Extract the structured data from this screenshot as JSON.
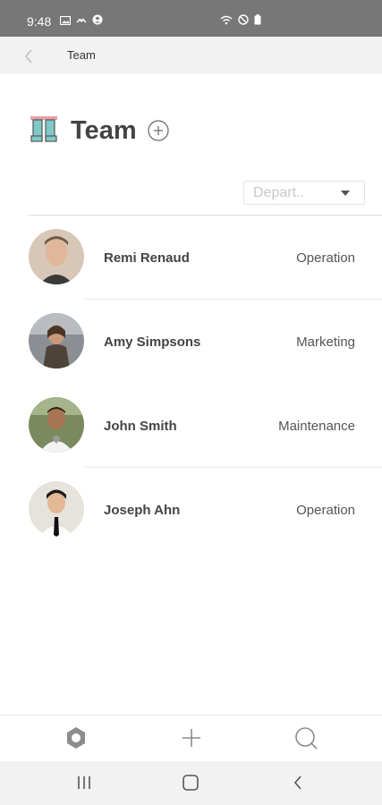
{
  "status_bar": {
    "time": "9:48"
  },
  "app_bar": {
    "title": "Team"
  },
  "header": {
    "title": "Team"
  },
  "filter": {
    "department_placeholder": "Depart..",
    "selected": ""
  },
  "members": [
    {
      "name": "Remi Renaud",
      "department": "Operation"
    },
    {
      "name": "Amy Simpsons",
      "department": "Marketing"
    },
    {
      "name": "John Smith",
      "department": "Maintenance"
    },
    {
      "name": "Joseph Ahn",
      "department": "Operation"
    }
  ],
  "bottom_nav": {
    "items": [
      "settings-icon",
      "add-icon",
      "search-icon"
    ]
  },
  "colors": {
    "status_bar": "#777777",
    "app_bar": "#f2f2f2",
    "icon_gray": "#8c8c8c",
    "logo_teal": "#7fc9c8",
    "logo_pink": "#e8a0a6"
  }
}
